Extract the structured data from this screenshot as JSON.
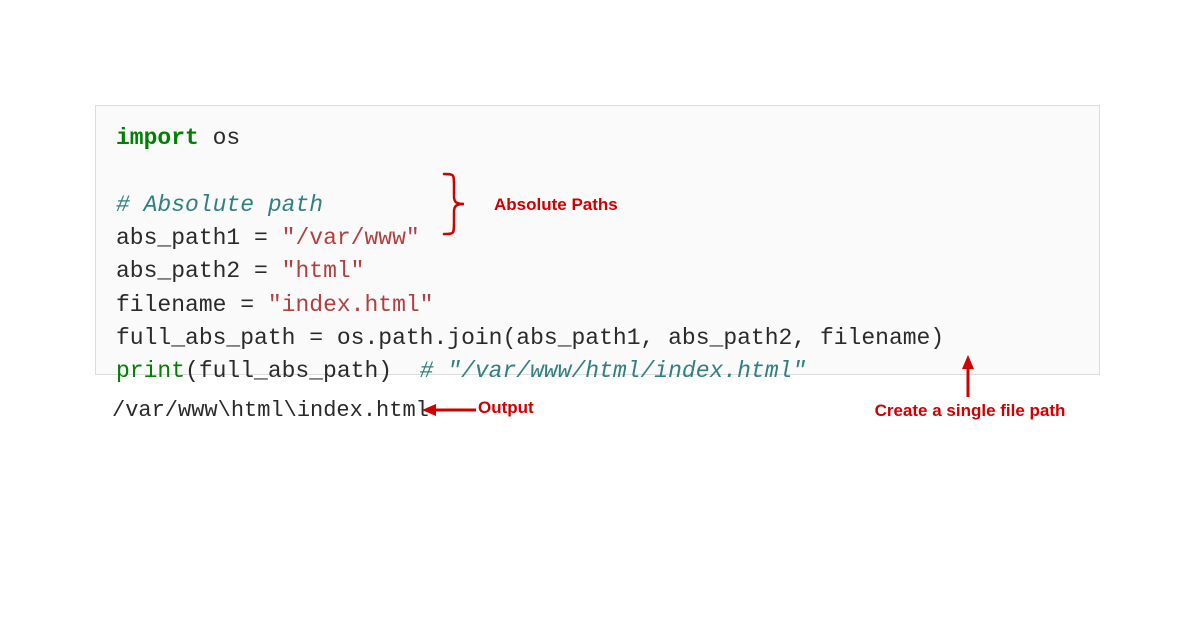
{
  "code": {
    "line1": {
      "import": "import",
      "module": " os"
    },
    "line2": "",
    "line3": {
      "comment": "# Absolute path"
    },
    "line4": {
      "var": "abs_path1 ",
      "eq": "=",
      "sp": " ",
      "str": "\"/var/www\""
    },
    "line5": {
      "var": "abs_path2 ",
      "eq": "=",
      "sp": " ",
      "str": "\"html\""
    },
    "line6": {
      "var": "filename ",
      "eq": "=",
      "sp": " ",
      "str": "\"index.html\""
    },
    "line7": {
      "var": "full_abs_path ",
      "eq": "=",
      "sp": " ",
      "rhs": "os.path.join(abs_path1, abs_path2, filename)"
    },
    "line8": {
      "fn": "print",
      "args": "(full_abs_path)  ",
      "comment": "# \"/var/www/html/index.html\""
    }
  },
  "output": "/var/www\\html\\index.html",
  "annotations": {
    "absolute_paths": "Absolute Paths",
    "output": "Output",
    "single_file": "Create a single file path"
  },
  "colors": {
    "annotation": "#d10000",
    "keyword": "#008000",
    "comment": "#308080",
    "string": "#b04040"
  }
}
